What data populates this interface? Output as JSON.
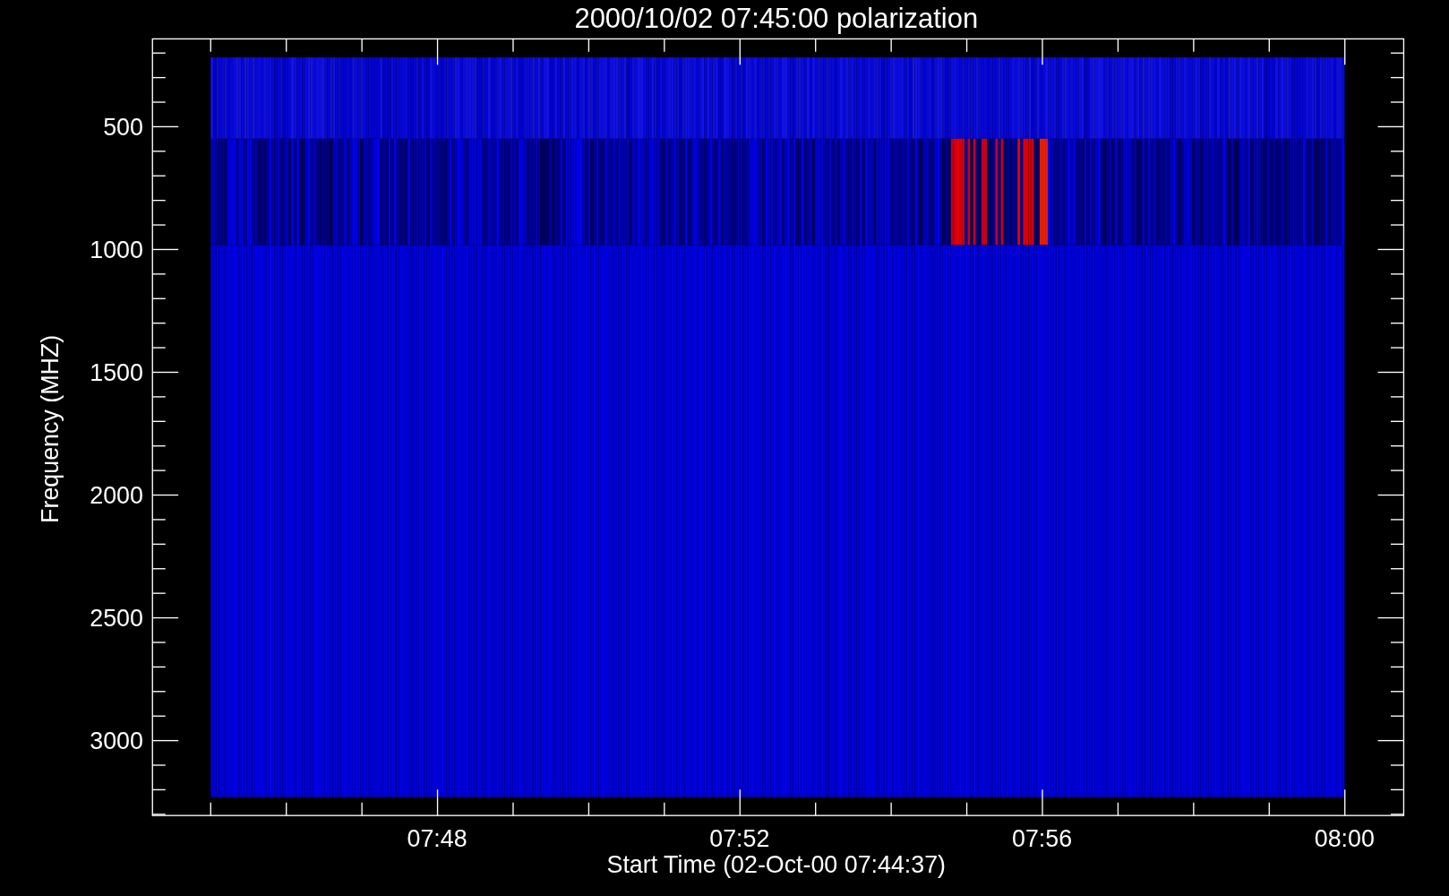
{
  "title": "2000/10/02 07:45:00 polarization",
  "y_axis": {
    "label": "Frequency (MHZ)",
    "ticks": [
      "500",
      "1000",
      "1500",
      "2000",
      "2500",
      "3000"
    ]
  },
  "x_axis": {
    "label": "Start Time (02-Oct-00 07:44:37)",
    "ticks": [
      "07:48",
      "07:52",
      "07:56",
      "08:00"
    ]
  }
}
